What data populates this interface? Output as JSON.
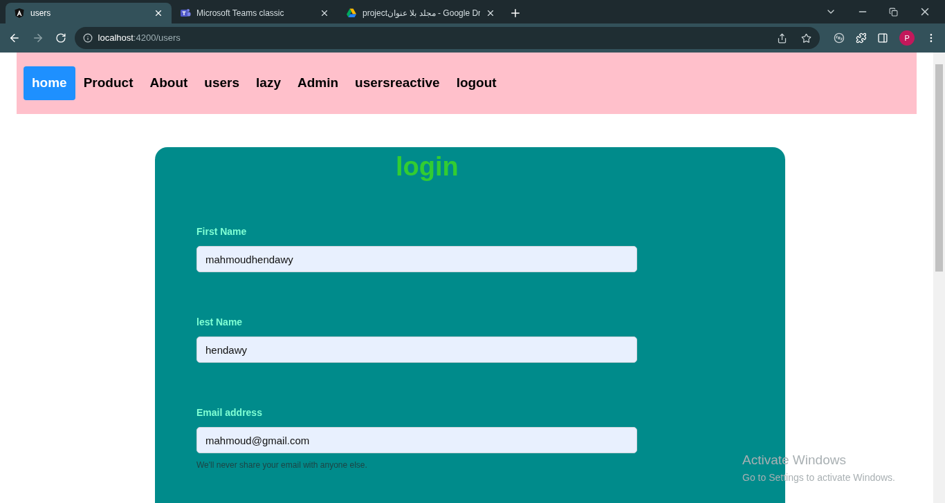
{
  "browser": {
    "tabs": [
      {
        "title": "users",
        "kind": "angular",
        "selected": true
      },
      {
        "title": "Microsoft Teams classic",
        "kind": "teams",
        "selected": false
      },
      {
        "title": "projectمجلد بلا عنوان - Google Dr",
        "kind": "drive",
        "selected": false
      }
    ],
    "url": {
      "host": "localhost",
      "path": ":4200/users"
    },
    "profile_initial": "P"
  },
  "nav": [
    {
      "label": "home",
      "selected": true
    },
    {
      "label": "Product",
      "selected": false
    },
    {
      "label": "About",
      "selected": false
    },
    {
      "label": "users",
      "selected": false
    },
    {
      "label": "lazy",
      "selected": false
    },
    {
      "label": "Admin",
      "selected": false
    },
    {
      "label": "usersreactive",
      "selected": false
    },
    {
      "label": "logout",
      "selected": false
    }
  ],
  "form": {
    "title": "login",
    "fields": [
      {
        "label": "First Name",
        "value": "mahmoudhendawy"
      },
      {
        "label": "lest Name",
        "value": "hendawy"
      },
      {
        "label": "Email address",
        "value": "mahmoud@gmail.com",
        "help": "We'll never share your email with anyone else."
      }
    ]
  },
  "os_overlay": {
    "title": "Activate Windows",
    "subtitle": "Go to Settings to activate Windows."
  }
}
